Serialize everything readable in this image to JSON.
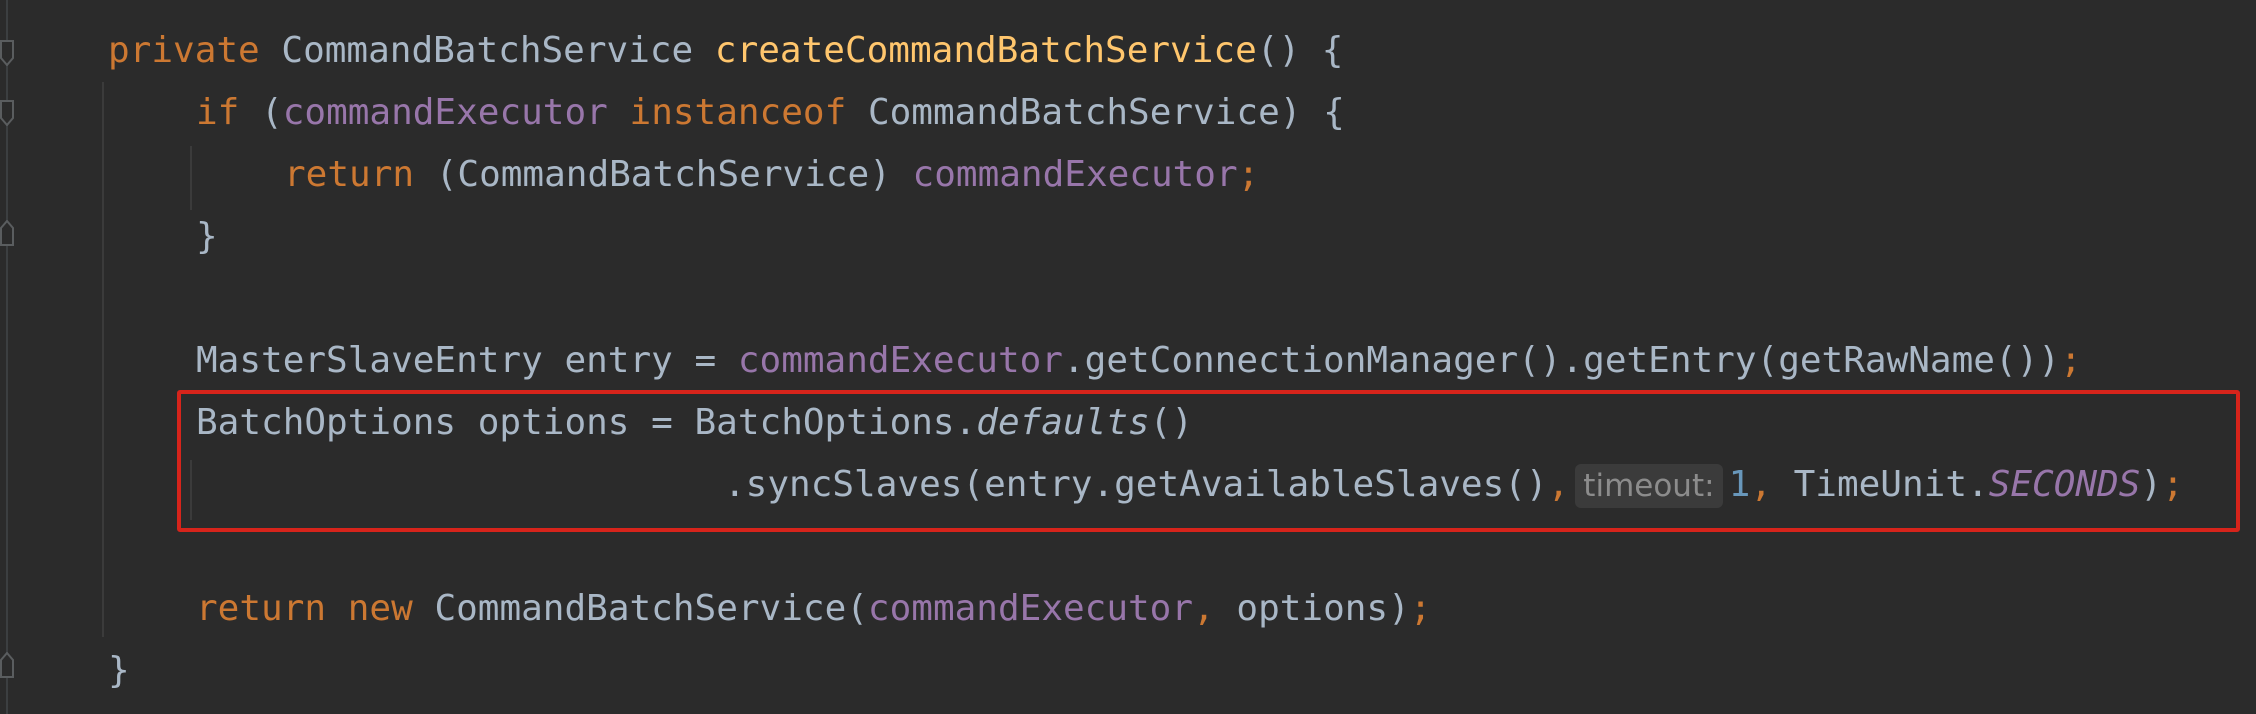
{
  "code": {
    "line1": {
      "private": "private",
      "type": "CommandBatchService",
      "method": "createCommandBatchService",
      "tail": "() {"
    },
    "line2": {
      "if": "if",
      "open": " (",
      "field": "commandExecutor",
      "instanceof": "instanceof",
      "tail": "CommandBatchService) {"
    },
    "line3": {
      "return": "return",
      "cast": " (CommandBatchService) ",
      "field": "commandExecutor",
      "semi": ";"
    },
    "line4": {
      "brace": "}"
    },
    "line6": {
      "decl": "MasterSlaveEntry entry = ",
      "field": "commandExecutor",
      "rest": ".getConnectionManager().getEntry(getRawName())",
      "semi": ";"
    },
    "line7": {
      "decl": "BatchOptions options = BatchOptions.",
      "method": "defaults",
      "tail": "()"
    },
    "line8": {
      "call": ".syncSlaves(entry.getAvailableSlaves()",
      "comma": ",",
      "hint": "timeout:",
      "num": "1",
      "comma2": ",",
      "unit": " TimeUnit.",
      "const": "SECONDS",
      "close": ")",
      "semi": ";"
    },
    "line10": {
      "return": "return",
      "new": "new",
      "ctor": " CommandBatchService(",
      "field": "commandExecutor",
      "comma": ",",
      "arg": " options)",
      "semi": ";"
    },
    "line11": {
      "brace": "}"
    }
  },
  "icons": {
    "fold": "fold-marker-icon"
  },
  "colors": {
    "background": "#2b2b2b",
    "keyword": "#cc7832",
    "method": "#ffc66d",
    "field": "#9876aa",
    "number": "#6897bb",
    "text": "#a9b7c6",
    "highlight_border": "#d6241b"
  }
}
